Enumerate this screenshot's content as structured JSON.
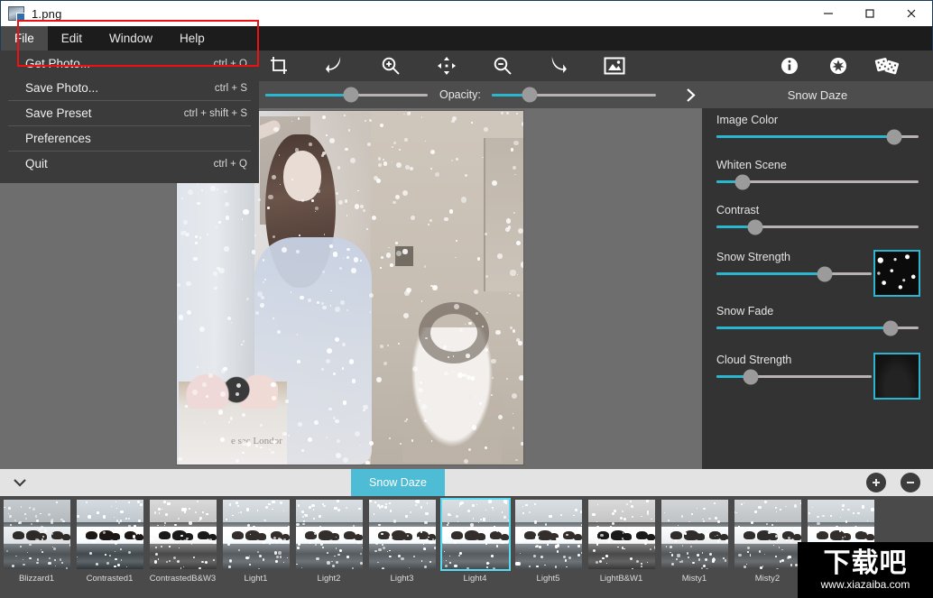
{
  "window": {
    "title": "1.png",
    "icon": "image-file-icon",
    "controls": [
      {
        "name": "minimize-button",
        "glyph": "minimize-icon"
      },
      {
        "name": "maximize-button",
        "glyph": "maximize-icon"
      },
      {
        "name": "close-button",
        "glyph": "close-icon"
      }
    ]
  },
  "menubar": {
    "items": [
      {
        "label": "File",
        "active": true
      },
      {
        "label": "Edit",
        "active": false
      },
      {
        "label": "Window",
        "active": false
      },
      {
        "label": "Help",
        "active": false
      }
    ]
  },
  "file_menu": {
    "items": [
      {
        "label": "Get Photo...",
        "accel": "ctrl + O"
      },
      {
        "label": "Save Photo...",
        "accel": "ctrl + S"
      },
      {
        "label": "Save Preset",
        "accel": "ctrl + shift + S"
      },
      {
        "label": "Preferences",
        "accel": ""
      },
      {
        "label": "Quit",
        "accel": "ctrl + Q"
      }
    ],
    "highlight_color": "#ee1111"
  },
  "toolbar": {
    "icons": [
      {
        "name": "crop-icon",
        "title": "Crop"
      },
      {
        "name": "undo-icon",
        "title": "Undo"
      },
      {
        "name": "zoom-in-icon",
        "title": "Zoom In"
      },
      {
        "name": "move-icon",
        "title": "Move"
      },
      {
        "name": "zoom-out-icon",
        "title": "Zoom Out"
      },
      {
        "name": "redo-icon",
        "title": "Redo"
      },
      {
        "name": "image-export-icon",
        "title": "Image"
      }
    ],
    "right_icons": [
      {
        "name": "info-icon",
        "title": "Info"
      },
      {
        "name": "snowflake-settings-icon",
        "title": "Settings"
      },
      {
        "name": "dice-icon",
        "title": "Randomize"
      }
    ]
  },
  "subtoolbar": {
    "brush_slider": {
      "value": 53
    },
    "opacity_label": "Opacity:",
    "opacity_slider": {
      "value": 23
    },
    "expand_icon": "chevron-right-icon"
  },
  "right_panel": {
    "title": "Snow Daze",
    "accent": "#2ab6cf",
    "controls": [
      {
        "label": "Image Color",
        "value": 88,
        "preview": null
      },
      {
        "label": "Whiten Scene",
        "value": 13,
        "preview": null
      },
      {
        "label": "Contrast",
        "value": 19,
        "preview": null
      },
      {
        "label": "Snow Strength",
        "value": 70,
        "preview": "snow-texture"
      },
      {
        "label": "Snow Fade",
        "value": 86,
        "preview": null
      },
      {
        "label": "Cloud Strength",
        "value": 22,
        "preview": "cloud-texture"
      }
    ]
  },
  "canvas": {
    "image_caption": "e sac\nLondor"
  },
  "preset_bar": {
    "collapse_icon": "chevron-down-icon",
    "active_tab": "Snow Daze",
    "tab_color": "#4ebcd4",
    "add_label": "+",
    "remove_label": "−"
  },
  "presets": [
    {
      "label": "Blizzard1",
      "style": "blizzard",
      "selected": false
    },
    {
      "label": "Contrasted1",
      "style": "contrast",
      "selected": false
    },
    {
      "label": "ContrastedB&W3",
      "style": "contrast-bw",
      "selected": false
    },
    {
      "label": "Light1",
      "style": "light",
      "selected": false
    },
    {
      "label": "Light2",
      "style": "light",
      "selected": false
    },
    {
      "label": "Light3",
      "style": "light",
      "selected": false
    },
    {
      "label": "Light4",
      "style": "light",
      "selected": true
    },
    {
      "label": "Light5",
      "style": "light",
      "selected": false
    },
    {
      "label": "LightB&W1",
      "style": "contrast-bw",
      "selected": false
    },
    {
      "label": "Misty1",
      "style": "misty",
      "selected": false
    },
    {
      "label": "Misty2",
      "style": "misty",
      "selected": false
    },
    {
      "label": "",
      "style": "light",
      "selected": false
    }
  ],
  "watermark": {
    "cn": "下载吧",
    "url": "www.xiazaiba.com"
  }
}
